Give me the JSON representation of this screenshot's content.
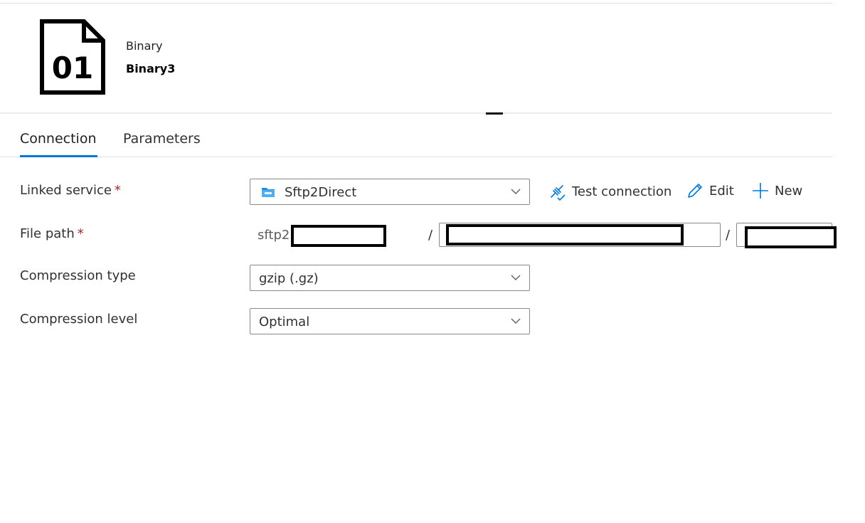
{
  "header": {
    "icon_text": "01",
    "dataset_type": "Binary",
    "dataset_name": "Binary3"
  },
  "tabs": [
    {
      "label": "Connection",
      "active": true
    },
    {
      "label": "Parameters",
      "active": false
    }
  ],
  "form": {
    "linked_service": {
      "label": "Linked service",
      "required_mark": "*",
      "value": "Sftp2Direct",
      "icon": "sftp-folder-icon"
    },
    "actions": {
      "test_connection": "Test connection",
      "edit": "Edit",
      "new": "New"
    },
    "file_path": {
      "label": "File path",
      "required_mark": "*",
      "prefix": "sftp2.",
      "separator": "/"
    },
    "compression_type": {
      "label": "Compression type",
      "value": "gzip (.gz)"
    },
    "compression_level": {
      "label": "Compression level",
      "value": "Optimal"
    }
  },
  "colors": {
    "accent": "#0078d4",
    "required": "#a4262c"
  }
}
